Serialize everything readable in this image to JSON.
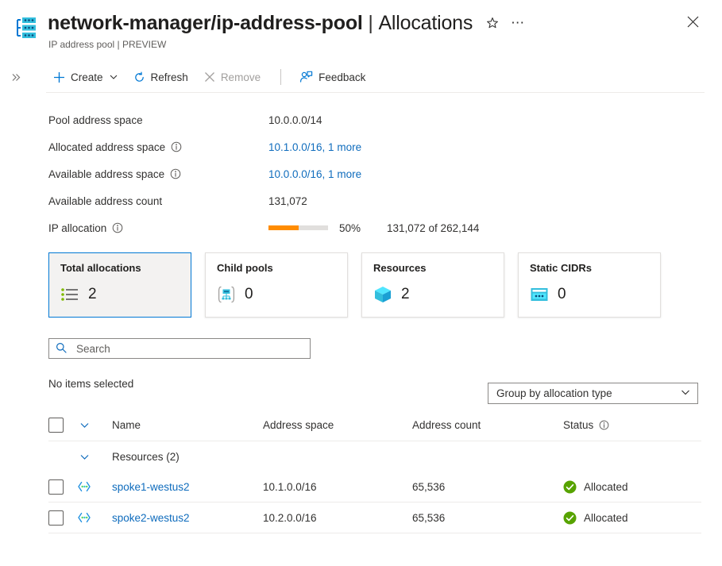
{
  "header": {
    "resource_icon": "ip-address-pool-icon",
    "title_main": "network-manager/ip-address-pool",
    "title_separator": "|",
    "title_section": "Allocations",
    "subtitle": "IP address pool | PREVIEW",
    "favorite_icon": "star-icon",
    "more_icon": "ellipsis-icon",
    "close_icon": "close-icon"
  },
  "toolbar": {
    "expand_nav_icon": "double-chevron-right-icon",
    "create_label": "Create",
    "create_icon": "plus-icon",
    "create_chevron_icon": "chevron-down-icon",
    "refresh_label": "Refresh",
    "refresh_icon": "refresh-icon",
    "remove_label": "Remove",
    "remove_icon": "close-x-icon",
    "remove_disabled": true,
    "feedback_label": "Feedback",
    "feedback_icon": "feedback-person-icon"
  },
  "properties": [
    {
      "label": "Pool address space",
      "value": "10.0.0.0/14",
      "is_link": false,
      "has_info": false
    },
    {
      "label": "Allocated address space",
      "value": "10.1.0.0/16, 1 more",
      "is_link": true,
      "has_info": true
    },
    {
      "label": "Available address space",
      "value": "10.0.0.0/16, 1 more",
      "is_link": true,
      "has_info": true
    },
    {
      "label": "Available address count",
      "value": "131,072",
      "is_link": false,
      "has_info": false
    }
  ],
  "ip_allocation": {
    "label": "IP allocation",
    "has_info": true,
    "percent_text": "50%",
    "percent_value": 50,
    "detail": "131,072 of 262,144",
    "bar_color": "#ff8c00",
    "track_color": "#e1dfdd"
  },
  "cards": [
    {
      "title": "Total allocations",
      "count": "2",
      "icon": "list-bullet-icon",
      "selected": true
    },
    {
      "title": "Child pools",
      "count": "0",
      "icon": "child-pool-icon",
      "selected": false
    },
    {
      "title": "Resources",
      "count": "2",
      "icon": "resource-cube-icon",
      "selected": false
    },
    {
      "title": "Static CIDRs",
      "count": "0",
      "icon": "static-cidr-icon",
      "selected": false
    }
  ],
  "search": {
    "placeholder": "Search",
    "value": "",
    "icon": "search-icon"
  },
  "selection_status": "No items selected",
  "group_by": {
    "selected": "Group by allocation type",
    "chevron_icon": "chevron-down-icon"
  },
  "table": {
    "columns": {
      "name": "Name",
      "address_space": "Address space",
      "address_count": "Address count",
      "status": "Status"
    },
    "status_has_info": true,
    "select_all_icon": "checkbox-icon",
    "header_chevron_icon": "chevron-down-icon",
    "groups": [
      {
        "label": "Resources (2)",
        "chevron_icon": "chevron-down-icon",
        "rows": [
          {
            "name": "spoke1-westus2",
            "icon": "virtual-network-icon",
            "address_space": "10.1.0.0/16",
            "address_count": "65,536",
            "status": "Allocated",
            "status_icon": "success-check-icon"
          },
          {
            "name": "spoke2-westus2",
            "icon": "virtual-network-icon",
            "address_space": "10.2.0.0/16",
            "address_count": "65,536",
            "status": "Allocated",
            "status_icon": "success-check-icon"
          }
        ]
      }
    ]
  },
  "colors": {
    "link": "#0f6cbd",
    "accent": "#0078d4",
    "success": "#57a300",
    "warning_orange": "#ff8c00",
    "cyan_icon": "#32bedd"
  }
}
